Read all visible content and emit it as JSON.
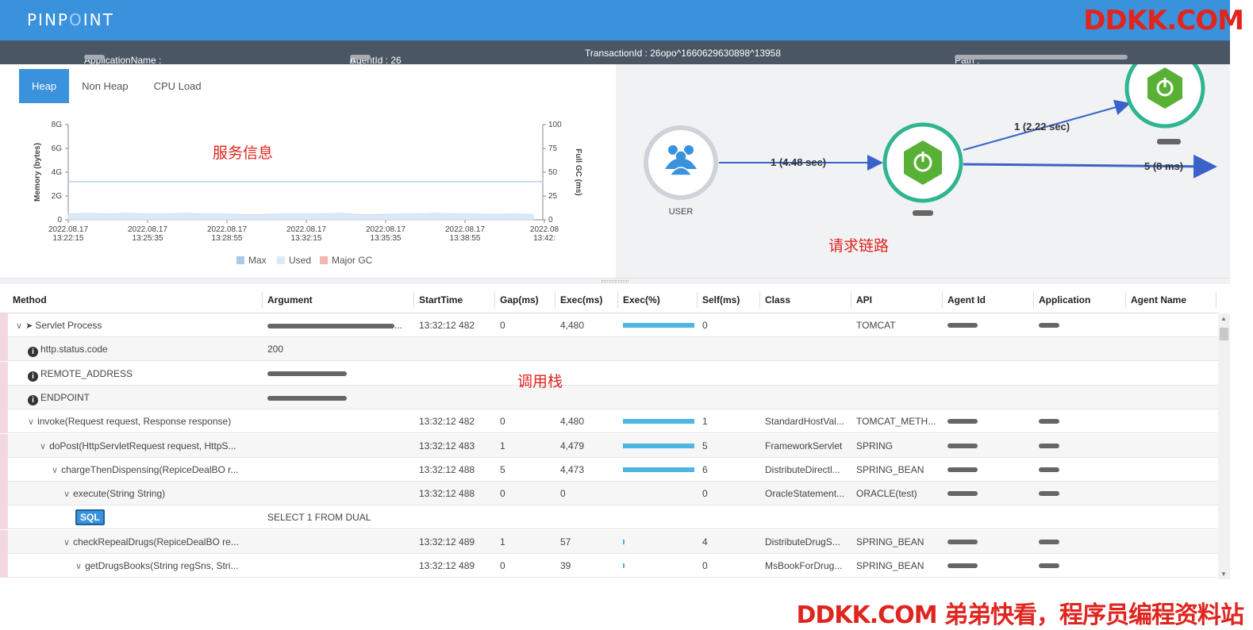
{
  "header": {
    "logo": "PINPOINT",
    "logo_pre": "PINP",
    "logo_mid": "O",
    "logo_post": "INT",
    "watermark": "DDKK.COM"
  },
  "info": {
    "application_label": "ApplicationName :",
    "agent_label": "AgentId : 26",
    "agent_suffix": "o",
    "transaction": "TransactionId : 26opo^1660629630898^13958",
    "path_label": "Path :"
  },
  "tabs": [
    {
      "label": "Heap"
    },
    {
      "label": "Non Heap"
    },
    {
      "label": "CPU Load"
    }
  ],
  "chart_data": {
    "type": "area",
    "ylabel": "Memory (bytes)",
    "y2label": "Full GC (ms)",
    "y_ticks": [
      "8G",
      "6G",
      "4G",
      "2G",
      "0"
    ],
    "y2_ticks": [
      "100",
      "75",
      "50",
      "25",
      "0"
    ],
    "x_ticks": [
      {
        "date": "2022.08.17",
        "time": "13:22:15"
      },
      {
        "date": "2022.08.17",
        "time": "13:25:35"
      },
      {
        "date": "2022.08.17",
        "time": "13:28:55"
      },
      {
        "date": "2022.08.17",
        "time": "13:32:15"
      },
      {
        "date": "2022.08.17",
        "time": "13:35:35"
      },
      {
        "date": "2022.08.17",
        "time": "13:38:55"
      },
      {
        "date": "2022.08",
        "time": "13:42:"
      }
    ],
    "ylim_gb": [
      0,
      8
    ],
    "series": [
      {
        "name": "Max",
        "value_gb": 3.2,
        "color": "#a9cbe8"
      },
      {
        "name": "Used",
        "values_gb": [
          0.5,
          0.55,
          0.5,
          0.55,
          0.5,
          0.5,
          0.55,
          0.5,
          0.5,
          0.45,
          0.45,
          0.5,
          0.5,
          0.5,
          0.55,
          0.45,
          0.45,
          0.5,
          0.5,
          0.55,
          0.5,
          0.5,
          0.45,
          0.5,
          0.45
        ],
        "color": "#dce9f6"
      },
      {
        "name": "Major GC",
        "values": [],
        "color": "#f4b6b0"
      }
    ]
  },
  "annotations": {
    "service_info": "服务信息",
    "request_chain": "请求链路",
    "call_stack": "调用栈"
  },
  "server_map": {
    "user_label": "USER",
    "edge1": "1 (4.48 sec)",
    "edge2": "1 (2.22 sec)",
    "edge3": "5 (8 ms)",
    "colors": {
      "edge": "#3a63c8",
      "ring": "#2fb58f",
      "hex": "#58b135",
      "user": "#3b92dc"
    }
  },
  "grid": {
    "columns": [
      "Method",
      "Argument",
      "StartTime",
      "Gap(ms)",
      "Exec(ms)",
      "Exec(%)",
      "Self(ms)",
      "Class",
      "API",
      "Agent Id",
      "Application",
      "Agent Name"
    ],
    "rows": [
      {
        "indent": 0,
        "chev": true,
        "icon": "send",
        "method": "Servlet Process",
        "argument": "",
        "argument_suffix": "...",
        "start": "13:32:12 482",
        "gap": "0",
        "exec": "4,480",
        "pct": 100,
        "self": "0",
        "class": "",
        "api": "TOMCAT",
        "agent": "blur",
        "app": "blur"
      },
      {
        "indent": 1,
        "chev": false,
        "icon": "info",
        "method": "http.status.code",
        "argument": "200",
        "start": "",
        "gap": "",
        "exec": "",
        "pct": null,
        "self": "",
        "class": "",
        "api": "",
        "agent": "",
        "app": ""
      },
      {
        "indent": 1,
        "chev": false,
        "icon": "info",
        "method": "REMOTE_ADDRESS",
        "argument": "",
        "arg_blur": true,
        "start": "",
        "gap": "",
        "exec": "",
        "pct": null,
        "self": "",
        "class": "",
        "api": "",
        "agent": "",
        "app": ""
      },
      {
        "indent": 1,
        "chev": false,
        "icon": "info",
        "method": "ENDPOINT",
        "argument": "",
        "arg_blur": true,
        "start": "",
        "gap": "",
        "exec": "",
        "pct": null,
        "self": "",
        "class": "",
        "api": "",
        "agent": "",
        "app": ""
      },
      {
        "indent": 1,
        "chev": true,
        "icon": "",
        "method": "invoke(Request request, Response response)",
        "argument": "",
        "start": "13:32:12 482",
        "gap": "0",
        "exec": "4,480",
        "pct": 100,
        "self": "1",
        "class": "StandardHostVal...",
        "api": "TOMCAT_METH...",
        "agent": "blur",
        "app": "blur"
      },
      {
        "indent": 2,
        "chev": true,
        "icon": "",
        "method": "doPost(HttpServletRequest request, HttpS...",
        "argument": "",
        "start": "13:32:12 483",
        "gap": "1",
        "exec": "4,479",
        "pct": 100,
        "self": "5",
        "class": "FrameworkServlet",
        "api": "SPRING",
        "agent": "blur",
        "app": "blur"
      },
      {
        "indent": 3,
        "chev": true,
        "icon": "",
        "method": "chargeThenDispensing(RepiceDealBO r...",
        "argument": "",
        "start": "13:32:12 488",
        "gap": "5",
        "exec": "4,473",
        "pct": 100,
        "self": "6",
        "class": "DistributeDirectl...",
        "api": "SPRING_BEAN",
        "agent": "blur",
        "app": "blur"
      },
      {
        "indent": 4,
        "chev": true,
        "icon": "",
        "method": "execute(String String)",
        "argument": "",
        "start": "13:32:12 488",
        "gap": "0",
        "exec": "0",
        "pct": 0,
        "self": "0",
        "class": "OracleStatement...",
        "api": "ORACLE(test)",
        "agent": "blur",
        "app": "blur"
      },
      {
        "indent": 5,
        "chev": false,
        "icon": "sql",
        "method": "SQL",
        "argument": "SELECT 1 FROM DUAL",
        "start": "",
        "gap": "",
        "exec": "",
        "pct": null,
        "self": "",
        "class": "",
        "api": "",
        "agent": "",
        "app": ""
      },
      {
        "indent": 4,
        "chev": true,
        "icon": "",
        "method": "checkRepealDrugs(RepiceDealBO re...",
        "argument": "",
        "start": "13:32:12 489",
        "gap": "1",
        "exec": "57",
        "pct": 1.3,
        "self": "4",
        "class": "DistributeDrugS...",
        "api": "SPRING_BEAN",
        "agent": "blur",
        "app": "blur"
      },
      {
        "indent": 5,
        "chev": true,
        "icon": "",
        "method": "getDrugsBooks(String regSns, Stri...",
        "argument": "",
        "start": "13:32:12 489",
        "gap": "0",
        "exec": "39",
        "pct": 0.9,
        "self": "0",
        "class": "MsBookForDrug...",
        "api": "SPRING_BEAN",
        "agent": "blur",
        "app": "blur"
      }
    ]
  },
  "footer": {
    "watermark": "DDKK.COM 弟弟快看，程序员编程资料站"
  }
}
